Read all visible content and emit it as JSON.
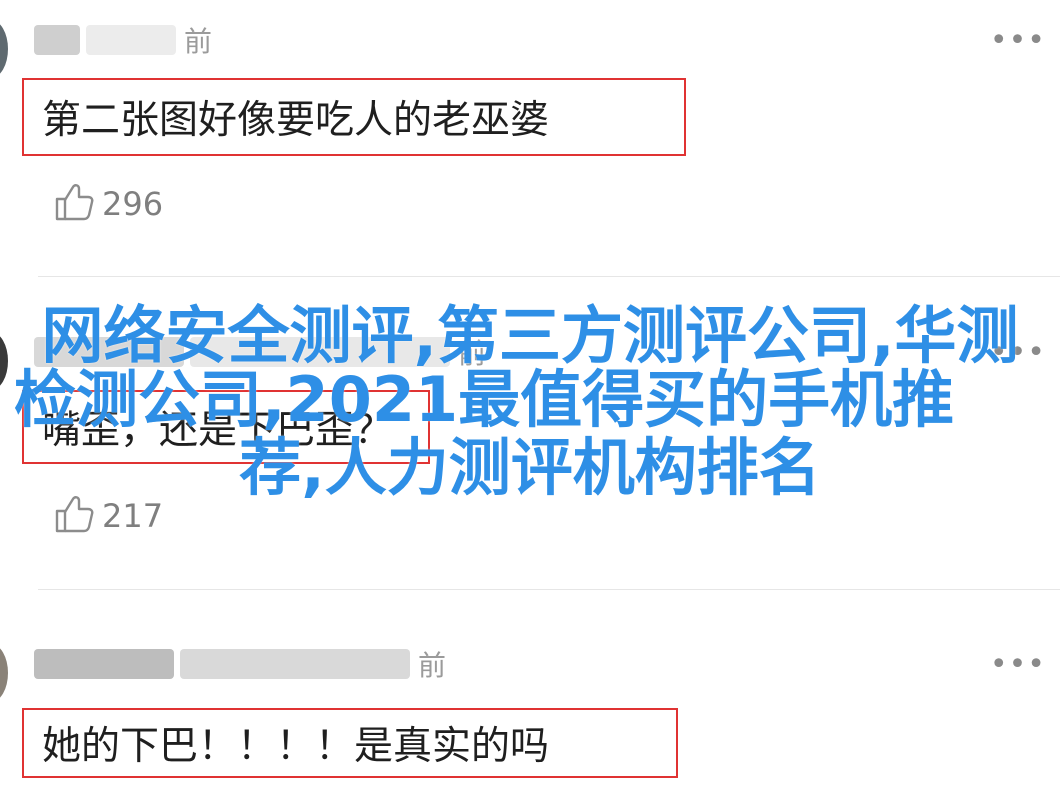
{
  "comments": [
    {
      "meta_suffix": "前",
      "text": "第二张图好像要吃人的老巫婆",
      "likes": "296",
      "more": "•••"
    },
    {
      "meta_suffix": "前",
      "text": "嘴歪，还是下巴歪？",
      "likes": "217",
      "more": "•••"
    },
    {
      "meta_suffix": "前",
      "text": "她的下巴！！！！是真实的吗",
      "more": "•••"
    }
  ],
  "overlay": {
    "line1": "网络安全测评,第三方测评公司,华测",
    "line2": "检测公司,2021最值得买的手机推",
    "line3": "荐,人力测评机构排名"
  },
  "colors": {
    "highlight_border": "#e03333",
    "overlay_text": "#2e8fe6"
  },
  "icons": {
    "like": "thumbs-up-icon",
    "more": "more-dots-icon"
  }
}
